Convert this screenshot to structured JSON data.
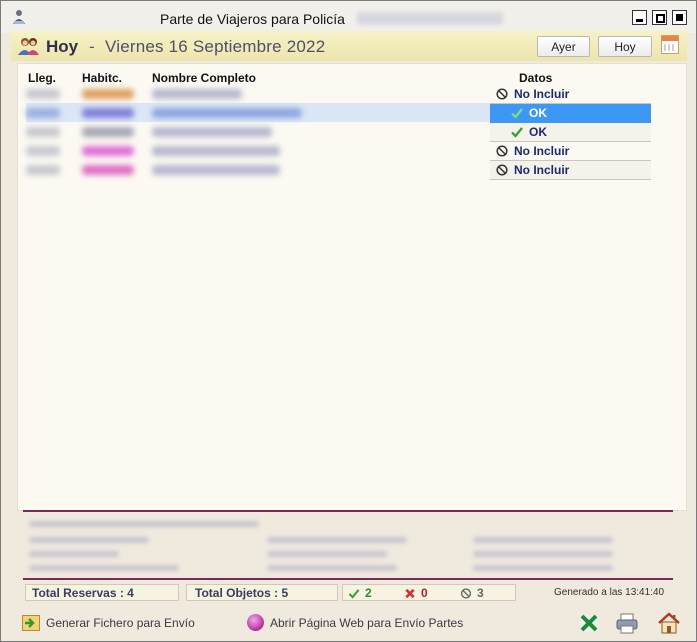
{
  "window": {
    "title": "Parte de Viajeros para Policía"
  },
  "header": {
    "today_label": "Hoy",
    "separator": "-",
    "date": "Viernes 16 Septiembre 2022",
    "btn_ayer": "Ayer",
    "btn_hoy": "Hoy"
  },
  "table": {
    "columns": {
      "lleg": "Lleg.",
      "habitc": "Habitc.",
      "nombre": "Nombre Completo",
      "datos": "Datos"
    },
    "rows": [
      {
        "datos": "No Incluir",
        "status": "no-incluir",
        "room_color": "#e0a060"
      },
      {
        "datos": "OK",
        "status": "ok",
        "selected": true,
        "room_color": "#8080d8"
      },
      {
        "datos": "OK",
        "status": "ok",
        "room_color": "#a8a8b8"
      },
      {
        "datos": "No Incluir",
        "status": "no-incluir",
        "room_color": "#e070d8"
      },
      {
        "datos": "No Incluir",
        "status": "no-incluir",
        "room_color": "#e070c8"
      }
    ]
  },
  "stats": {
    "total_reservas": "Total Reservas : 4",
    "total_objetos": "Total Objetos : 5",
    "ok_count": "2",
    "error_count": "0",
    "excluded_count": "3",
    "generated": "Generado a las 13:41:40"
  },
  "bottom": {
    "generar": "Generar Fichero para Envío",
    "abrir": "Abrir Página Web para Envío Partes"
  },
  "colors": {
    "selection": "#3d98f5",
    "accent": "#7a2a5a",
    "header_bg": "#f2ecbb"
  }
}
